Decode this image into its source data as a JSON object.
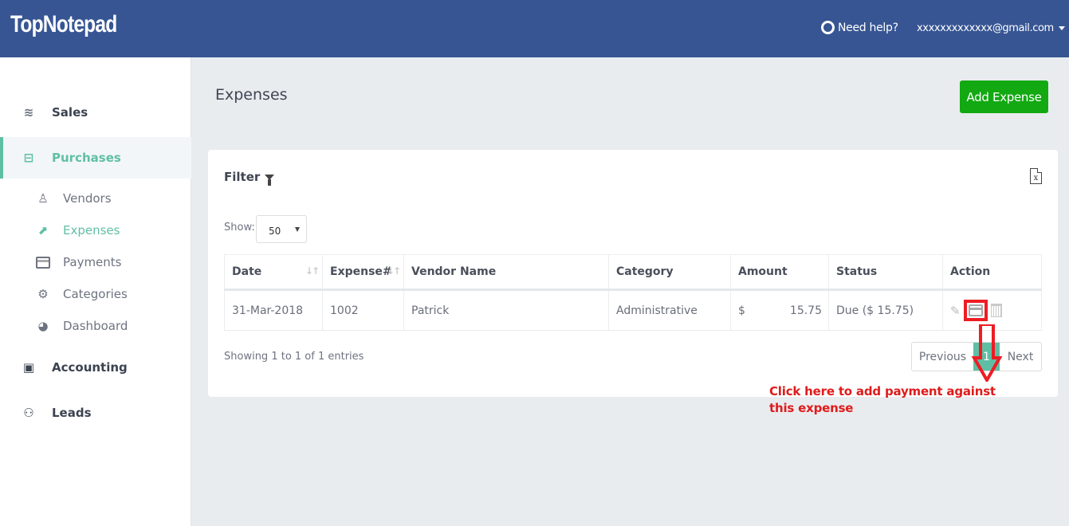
{
  "header": {
    "logo": "TopNotepad",
    "help_label": "Need help?",
    "user_email": "xxxxxxxxxxxxx@gmail.com"
  },
  "sidebar": {
    "items": [
      {
        "label": "Sales",
        "icon": "layers-icon",
        "level": "main"
      },
      {
        "label": "Purchases",
        "icon": "minus-square-icon",
        "level": "main",
        "active": true
      },
      {
        "label": "Vendors",
        "icon": "user-outline-icon",
        "level": "sub"
      },
      {
        "label": "Expenses",
        "icon": "share-square-icon",
        "level": "sub",
        "active": true
      },
      {
        "label": "Payments",
        "icon": "credit-card-icon",
        "level": "sub"
      },
      {
        "label": "Categories",
        "icon": "gear-icon",
        "level": "sub"
      },
      {
        "label": "Dashboard",
        "icon": "gauge-icon",
        "level": "sub"
      },
      {
        "label": "Accounting",
        "icon": "bar-chart-icon",
        "level": "main"
      },
      {
        "label": "Leads",
        "icon": "users-icon",
        "level": "main"
      }
    ]
  },
  "main": {
    "title": "Expenses",
    "add_button": "Add Expense",
    "filter_label": "Filter",
    "show_label": "Show:",
    "page_size": "50",
    "columns": [
      "Date",
      "Expense#",
      "Vendor Name",
      "Category",
      "Amount",
      "Status",
      "Action"
    ],
    "rows": [
      {
        "date": "31-Mar-2018",
        "expense_no": "1002",
        "vendor": "Patrick",
        "category": "Administrative",
        "currency": "$",
        "amount": "15.75",
        "status": "Due ($ 15.75)"
      }
    ],
    "showing_text": "Showing 1 to 1 of 1 entries",
    "pagination": {
      "previous": "Previous",
      "current": "1",
      "next": "Next"
    }
  },
  "annotation": {
    "text": "Click here to add payment against this expense",
    "color": "#e01b1b"
  },
  "colors": {
    "header_bg": "#375593",
    "accent": "#5fbfa4",
    "add_button": "#12a912"
  }
}
